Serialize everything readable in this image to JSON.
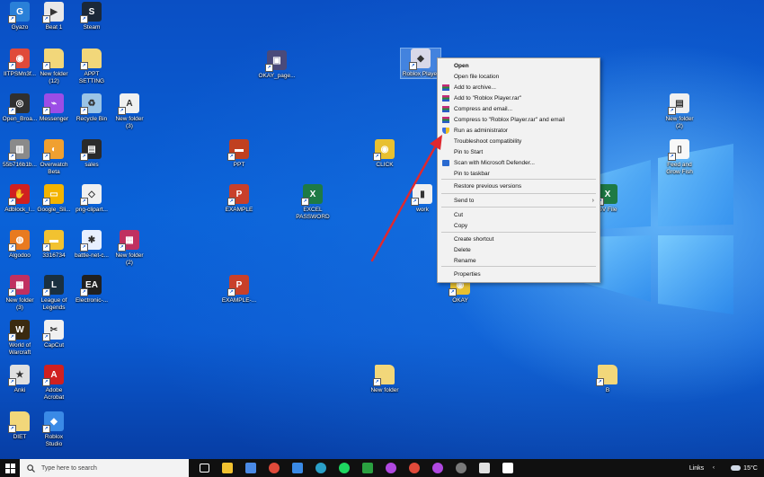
{
  "desktop": {
    "icons": [
      {
        "label": "Gyazo",
        "color": "#2a80d8",
        "glyph": "G"
      },
      {
        "label": "Beat 1",
        "color": "#e8e8e8",
        "glyph": "▶"
      },
      {
        "label": "Steam",
        "color": "#1b2838",
        "glyph": "S"
      },
      {
        "label": "IITPSMn3f...",
        "color": "#e04a3a",
        "glyph": "◉"
      },
      {
        "label": "New folder\n(12)",
        "color": "#f2d77a",
        "glyph": ""
      },
      {
        "label": "APPT\nSETTING",
        "color": "#f2d77a",
        "glyph": ""
      },
      {
        "label": "OKAY_page...",
        "color": "#4a4a7a",
        "glyph": "▣"
      },
      {
        "label": "Roblox Player",
        "color": "#d8d8e8",
        "glyph": "◆"
      },
      {
        "label": "Open_Broa...",
        "color": "#303030",
        "glyph": "◎"
      },
      {
        "label": "Messenger",
        "color": "#9b4de6",
        "glyph": "⌁"
      },
      {
        "label": "Recycle Bin",
        "color": "#9ac4e6",
        "glyph": "♻"
      },
      {
        "label": "New folder\n(3)",
        "color": "#f0f0f0",
        "glyph": "A"
      },
      {
        "label": "New folder\n(2)",
        "color": "#f0f0f0",
        "glyph": "▤"
      },
      {
        "label": "55b716b1b...",
        "color": "#8a8a8a",
        "glyph": "▥"
      },
      {
        "label": "Overwatch\nBeta",
        "color": "#f0a030",
        "glyph": "◐"
      },
      {
        "label": "sales",
        "color": "#2a2a2a",
        "glyph": "▤"
      },
      {
        "label": "PPT",
        "color": "#c04020",
        "glyph": "▬"
      },
      {
        "label": "CLICK",
        "color": "#e8c030",
        "glyph": "◉"
      },
      {
        "label": "Feed and\nGrow Fish",
        "color": "#f8f8f8",
        "glyph": "▯"
      },
      {
        "label": "Adblock_l...",
        "color": "#d02020",
        "glyph": "✋"
      },
      {
        "label": "Google_Sli...",
        "color": "#f4b400",
        "glyph": "▭"
      },
      {
        "label": "png-clipart...",
        "color": "#f0f0f0",
        "glyph": "◇"
      },
      {
        "label": "EXAMPLE",
        "color": "#c8402a",
        "glyph": "P"
      },
      {
        "label": "EXCEL\nPASSWORD",
        "color": "#1e7a45",
        "glyph": "X"
      },
      {
        "label": "work",
        "color": "#f0f0f0",
        "glyph": "▮"
      },
      {
        "label": "SV File",
        "color": "#1e7a45",
        "glyph": "X"
      },
      {
        "label": "Algodoo",
        "color": "#e87a20",
        "glyph": "◍"
      },
      {
        "label": "3316734",
        "color": "#f2c230",
        "glyph": "▬"
      },
      {
        "label": "battle-net-c...",
        "color": "#e8f0ff",
        "glyph": "✱"
      },
      {
        "label": "New folder\n(2)",
        "color": "#c03060",
        "glyph": "▦"
      },
      {
        "label": "New folder\n(3)",
        "color": "#c03060",
        "glyph": "▦"
      },
      {
        "label": "League of\nLegends",
        "color": "#1a3040",
        "glyph": "L"
      },
      {
        "label": "Electronic-...",
        "color": "#202020",
        "glyph": "EA"
      },
      {
        "label": "EXAMPLE-...",
        "color": "#c8402a",
        "glyph": "P"
      },
      {
        "label": "OKAY",
        "color": "#e8c030",
        "glyph": "◉"
      },
      {
        "label": "World of\nWarcraft",
        "color": "#3a2a10",
        "glyph": "W"
      },
      {
        "label": "CapCut",
        "color": "#f0f0f0",
        "glyph": "✂"
      },
      {
        "label": "Anki",
        "color": "#e0e0e0",
        "glyph": "★"
      },
      {
        "label": "Adobe\nAcrobat",
        "color": "#d02020",
        "glyph": "A"
      },
      {
        "label": "New folder",
        "color": "#f2d77a",
        "glyph": ""
      },
      {
        "label": "B",
        "color": "#f2d77a",
        "glyph": ""
      },
      {
        "label": "DIET",
        "color": "#f2d77a",
        "glyph": ""
      },
      {
        "label": "Roblox\nStudio",
        "color": "#3a8ae6",
        "glyph": "◆"
      }
    ]
  },
  "context_menu": {
    "items": [
      {
        "label": "Open",
        "bold": true,
        "icon": ""
      },
      {
        "label": "Open file location",
        "icon": ""
      },
      {
        "label": "Add to archive...",
        "icon": "winrar-icon"
      },
      {
        "label": "Add to \"Roblox Player.rar\"",
        "icon": "winrar-icon"
      },
      {
        "label": "Compress and email...",
        "icon": "winrar-icon"
      },
      {
        "label": "Compress to \"Roblox Player.rar\" and email",
        "icon": "winrar-icon"
      },
      {
        "label": "Run as administrator",
        "icon": "shield-icon"
      },
      {
        "label": "Troubleshoot compatibility",
        "icon": ""
      },
      {
        "label": "Pin to Start",
        "icon": ""
      },
      {
        "label": "Scan with Microsoft Defender...",
        "icon": "defender-icon"
      },
      {
        "label": "Pin to taskbar",
        "icon": ""
      },
      {
        "label": "Restore previous versions",
        "icon": ""
      },
      {
        "label": "Send to",
        "icon": "",
        "submenu": true
      },
      {
        "label": "Cut",
        "icon": ""
      },
      {
        "label": "Copy",
        "icon": ""
      },
      {
        "label": "Create shortcut",
        "icon": ""
      },
      {
        "label": "Delete",
        "icon": ""
      },
      {
        "label": "Rename",
        "icon": ""
      },
      {
        "label": "Properties",
        "icon": ""
      }
    ]
  },
  "taskbar": {
    "search_placeholder": "Type here to search",
    "links_label": "Links",
    "weather_temp": "15°C",
    "pinned": [
      "task-view",
      "file-explorer",
      "microsoft-store",
      "chrome",
      "mail",
      "edge",
      "spotify",
      "xbox",
      "messenger",
      "chrome",
      "messenger",
      "steam-browser",
      "cloud-app",
      "capcut"
    ]
  },
  "colors": {
    "annotation_arrow": "#e0282e",
    "taskbar": "#101010",
    "menu_bg": "#f2f2f2"
  }
}
